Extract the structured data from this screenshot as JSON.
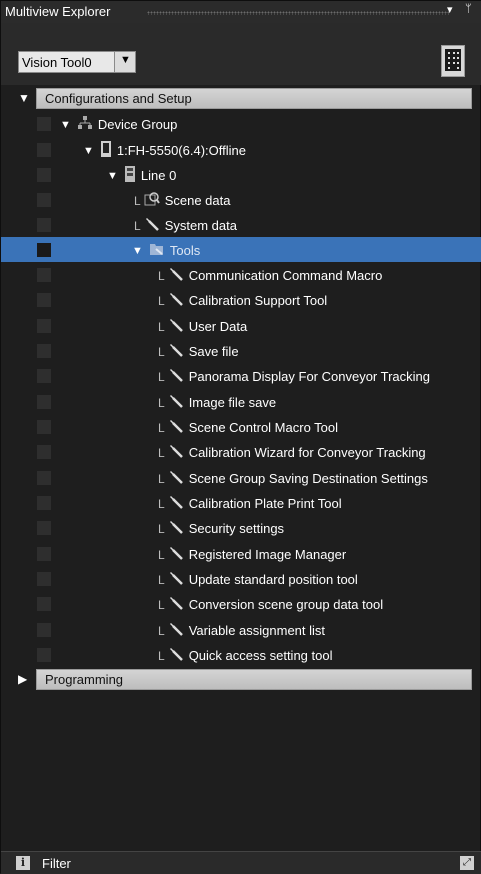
{
  "window": {
    "title": "Multiview Explorer",
    "menu_arrow": "▾",
    "pin_glyph": "ᛘ"
  },
  "toolbar": {
    "device_select": {
      "value": "Vision Tool0",
      "arrow": "▼"
    },
    "device_icon": "controller-icon"
  },
  "tree": {
    "configurations": {
      "label": "Configurations and Setup",
      "expanded": true,
      "toggle": "▼"
    },
    "device_group": {
      "label": "Device Group",
      "toggle": "▼",
      "icon": "device-group-icon"
    },
    "device": {
      "label": "1:FH-5550(6.4):Offline",
      "toggle": "▼",
      "icon": "controller-icon"
    },
    "line": {
      "label": "Line 0",
      "toggle": "▼",
      "icon": "line-icon"
    },
    "scene_data": {
      "label": "Scene data",
      "icon": "scene-data-icon"
    },
    "system_data": {
      "label": "System data",
      "icon": "wrench-icon"
    },
    "tools": {
      "label": "Tools",
      "toggle": "▼",
      "icon": "tools-folder-icon",
      "selected": true
    },
    "tool_items": [
      {
        "label": "Communication Command Macro"
      },
      {
        "label": "Calibration Support Tool"
      },
      {
        "label": "User Data"
      },
      {
        "label": "Save file"
      },
      {
        "label": "Panorama Display For Conveyor Tracking"
      },
      {
        "label": "Image file save"
      },
      {
        "label": "Scene Control Macro Tool"
      },
      {
        "label": "Calibration Wizard for Conveyor Tracking"
      },
      {
        "label": "Scene Group Saving Destination Settings"
      },
      {
        "label": "Calibration Plate Print Tool"
      },
      {
        "label": "Security settings"
      },
      {
        "label": "Registered Image Manager"
      },
      {
        "label": "Update standard position tool"
      },
      {
        "label": "Conversion scene group data tool"
      },
      {
        "label": "Variable assignment list"
      },
      {
        "label": "Quick access setting tool"
      }
    ],
    "programming": {
      "label": "Programming",
      "expanded": false,
      "toggle": "▶"
    }
  },
  "footer": {
    "info_glyph": "i",
    "filter_label": "Filter",
    "pin_glyph": "⤢"
  },
  "colors": {
    "selection": "#3a73b8",
    "panel_bg": "#1e1e1e",
    "section_bar": "#cfcfcf"
  }
}
